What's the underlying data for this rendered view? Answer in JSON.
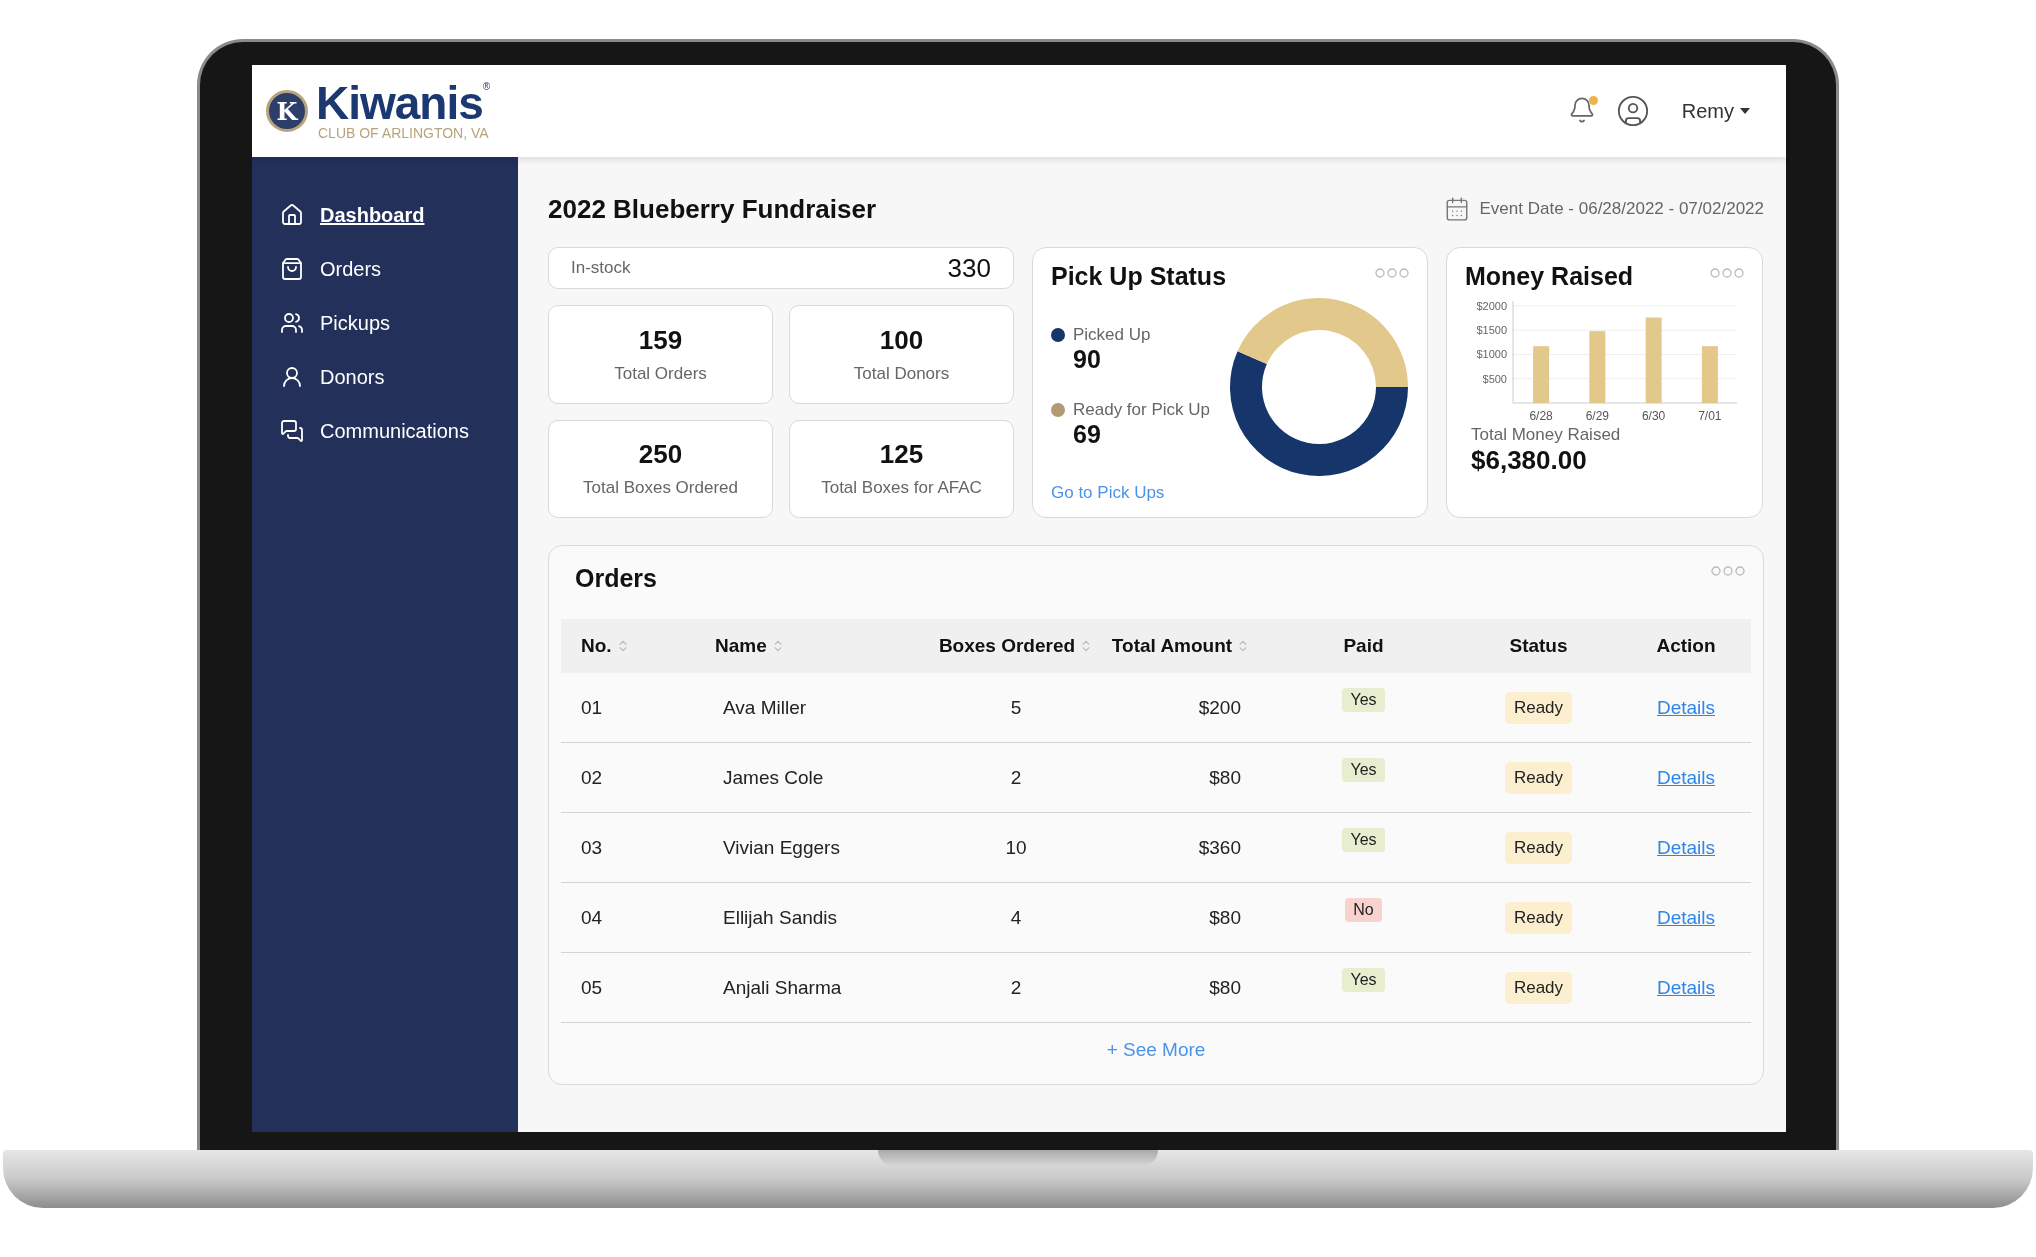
{
  "logo": {
    "emblem_letter": "K",
    "name": "Kiwanis",
    "mark": "®",
    "subtitle": "CLUB OF ARLINGTON, VA"
  },
  "header": {
    "notifications_unread": true,
    "user": "Remy"
  },
  "sidebar": {
    "items": [
      {
        "kind": "home",
        "label": "Dashboard",
        "selected": true
      },
      {
        "kind": "bag",
        "label": "Orders",
        "selected": false
      },
      {
        "kind": "pickup",
        "label": "Pickups",
        "selected": false
      },
      {
        "kind": "donors",
        "label": "Donors",
        "selected": false
      },
      {
        "kind": "chat",
        "label": "Communications",
        "selected": false
      }
    ]
  },
  "page": {
    "title": "2022 Blueberry Fundraiser",
    "event_date": "Event Date - 06/28/2022 - 07/02/2022"
  },
  "in_stock": {
    "label": "In-stock",
    "value": "330"
  },
  "stats": [
    {
      "value": "159",
      "label": "Total Orders"
    },
    {
      "value": "100",
      "label": "Total Donors"
    },
    {
      "value": "250",
      "label": "Total Boxes Ordered"
    },
    {
      "value": "125",
      "label": "Total Boxes for AFAC"
    }
  ],
  "pickup_status": {
    "title": "Pick Up Status",
    "legend": [
      {
        "value": "90",
        "color": "#15356b"
      },
      {
        "value": "69",
        "color": "#b29b74"
      }
    ],
    "link": "Go to Pick Ups",
    "chart_data": {
      "type": "donut",
      "categories": [
        "Picked Up",
        "Ready for Pick Up"
      ],
      "values": [
        56.6,
        43.4
      ]
    }
  },
  "money_raised": {
    "title": "Money Raised",
    "total_label": "Total Money Raised",
    "total": "$6,380.00",
    "chart_data": {
      "type": "bar",
      "categories": [
        "6/28",
        "6/29",
        "6/30",
        "7/01"
      ],
      "series": [
        {
          "color": "#e3c88c",
          "values": [
            1170,
            1480,
            1760,
            1170
          ]
        }
      ],
      "ylim": [
        0,
        2100
      ],
      "grid": true,
      "yticks": [
        {
          "value": 500,
          "label": "$500"
        },
        {
          "value": 1000,
          "label": "$1000"
        },
        {
          "value": 1500,
          "label": "$1500"
        },
        {
          "value": 2000,
          "label": "$2000"
        }
      ]
    }
  },
  "orders": {
    "title": "Orders",
    "columns": [
      {
        "label": "No.",
        "sortable": true
      },
      {
        "label": "Name",
        "sortable": true
      },
      {
        "label": "Boxes Ordered",
        "sortable": true
      },
      {
        "label": "Total Amount",
        "sortable": true
      },
      {
        "label": "Paid",
        "sortable": false
      },
      {
        "label": "Status",
        "sortable": false
      },
      {
        "label": "Action",
        "sortable": false
      }
    ],
    "rows": [
      {
        "no": "01",
        "name": "Ava Miller",
        "boxes": "5",
        "amount": "$200",
        "paid": "Yes",
        "paid_ok": true,
        "status": "Ready",
        "action": "Details"
      },
      {
        "no": "02",
        "name": "James Cole",
        "boxes": "2",
        "amount": "$80",
        "paid": "Yes",
        "paid_ok": true,
        "status": "Ready",
        "action": "Details"
      },
      {
        "no": "03",
        "name": "Vivian Eggers",
        "boxes": "10",
        "amount": "$360",
        "paid": "Yes",
        "paid_ok": true,
        "status": "Ready",
        "action": "Details"
      },
      {
        "no": "04",
        "name": "Ellijah Sandis",
        "boxes": "4",
        "amount": "$80",
        "paid": "No",
        "paid_ok": false,
        "status": "Ready",
        "action": "Details"
      },
      {
        "no": "05",
        "name": "Anjali Sharma",
        "boxes": "2",
        "amount": "$80",
        "paid": "Yes",
        "paid_ok": true,
        "status": "Ready",
        "action": "Details"
      }
    ],
    "see_more": "+ See More"
  }
}
